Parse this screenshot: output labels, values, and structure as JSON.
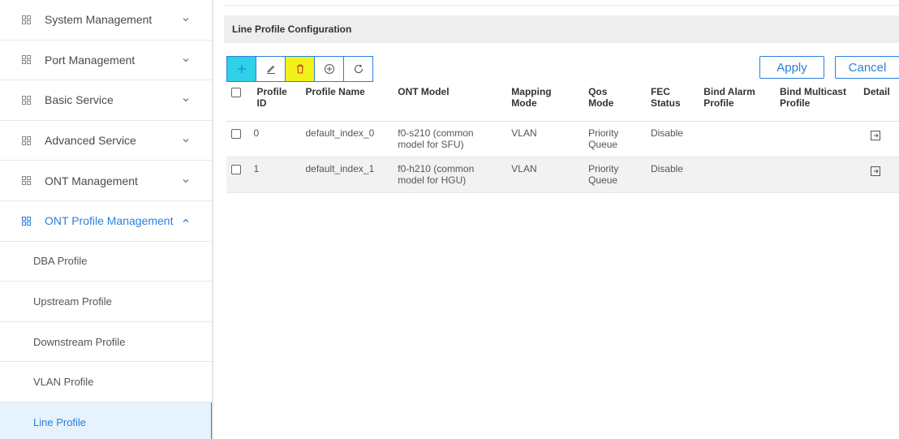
{
  "sidebar": {
    "items": [
      {
        "label": "System Management",
        "icon": "grid-icon",
        "chevron": "down"
      },
      {
        "label": "Port Management",
        "icon": "grid-icon",
        "chevron": "down"
      },
      {
        "label": "Basic Service",
        "icon": "grid-icon",
        "chevron": "down"
      },
      {
        "label": "Advanced Service",
        "icon": "grid-icon",
        "chevron": "down"
      },
      {
        "label": "ONT Management",
        "icon": "grid-icon",
        "chevron": "down"
      },
      {
        "label": "ONT Profile Management",
        "icon": "grid-icon",
        "chevron": "up",
        "expanded": true
      }
    ],
    "subitems": [
      {
        "label": "DBA Profile"
      },
      {
        "label": "Upstream Profile"
      },
      {
        "label": "Downstream Profile"
      },
      {
        "label": "VLAN Profile"
      },
      {
        "label": "Line Profile",
        "selected": true
      }
    ]
  },
  "main": {
    "title": "Line Profile Configuration",
    "toolbar": {
      "icons": [
        "plus-icon",
        "edit-icon",
        "delete-icon",
        "add-circle-icon",
        "refresh-icon"
      ]
    },
    "apply_label": "Apply",
    "cancel_label": "Cancel"
  },
  "table": {
    "headers": {
      "profile_id_1": "Profile",
      "profile_id_2": "ID",
      "profile_name": "Profile Name",
      "ont_model": "ONT Model",
      "mapping_mode_1": "Mapping",
      "mapping_mode_2": "Mode",
      "qos_mode_1": "Qos",
      "qos_mode_2": "Mode",
      "fec_status_1": "FEC",
      "fec_status_2": "Status",
      "bind_alarm_1": "Bind Alarm",
      "bind_alarm_2": "Profile",
      "bind_multicast_1": "Bind Multicast",
      "bind_multicast_2": "Profile",
      "detail": "Detail"
    },
    "rows": [
      {
        "id": "0",
        "name": "default_index_0",
        "model_1": "f0-s210 (common",
        "model_2": "model for SFU)",
        "mapping": "VLAN",
        "qos_1": "Priority",
        "qos_2": "Queue",
        "fec": "Disable",
        "bind_alarm": "",
        "bind_multicast": ""
      },
      {
        "id": "1",
        "name": "default_index_1",
        "model_1": "f0-h210 (common",
        "model_2": "model for HGU)",
        "mapping": "VLAN",
        "qos_1": "Priority",
        "qos_2": "Queue",
        "fec": "Disable",
        "bind_alarm": "",
        "bind_multicast": ""
      }
    ]
  },
  "colors": {
    "accent": "#2b7fd9",
    "add_button": "#2fd1e8",
    "delete_button": "#f2f21a",
    "selected_bg": "#e6f2fc",
    "title_bar_bg": "#eeeeee"
  }
}
